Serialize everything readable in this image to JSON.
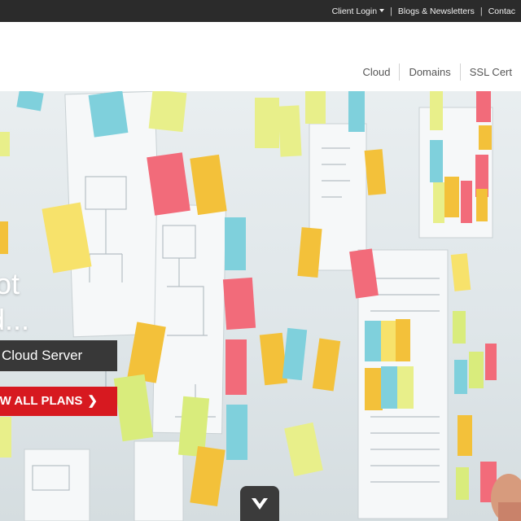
{
  "topbar": {
    "client_login": "Client Login",
    "blogs": "Blogs & Newsletters",
    "contact": "Contac"
  },
  "nav": {
    "cloud": "Cloud",
    "domains": "Domains",
    "ssl": "SSL Cert"
  },
  "hero": {
    "headline_line1": "lot",
    "headline_line2": "d...",
    "cloud_button": "Cloud Server",
    "plans_button": "OW ALL PLANS",
    "plans_chevron": "❯"
  },
  "colors": {
    "topbar_bg": "#2b2b2b",
    "accent_red": "#d71920",
    "dark_button": "#383838",
    "note_yellow": "#f7e26b",
    "note_pink": "#f26b7a",
    "note_blue": "#7fd0dc",
    "note_orange": "#f3c13a",
    "note_green": "#d9ec7c"
  },
  "icons": {
    "client_login_caret": "caret-down-icon",
    "scroll_down": "chevron-down-icon"
  }
}
